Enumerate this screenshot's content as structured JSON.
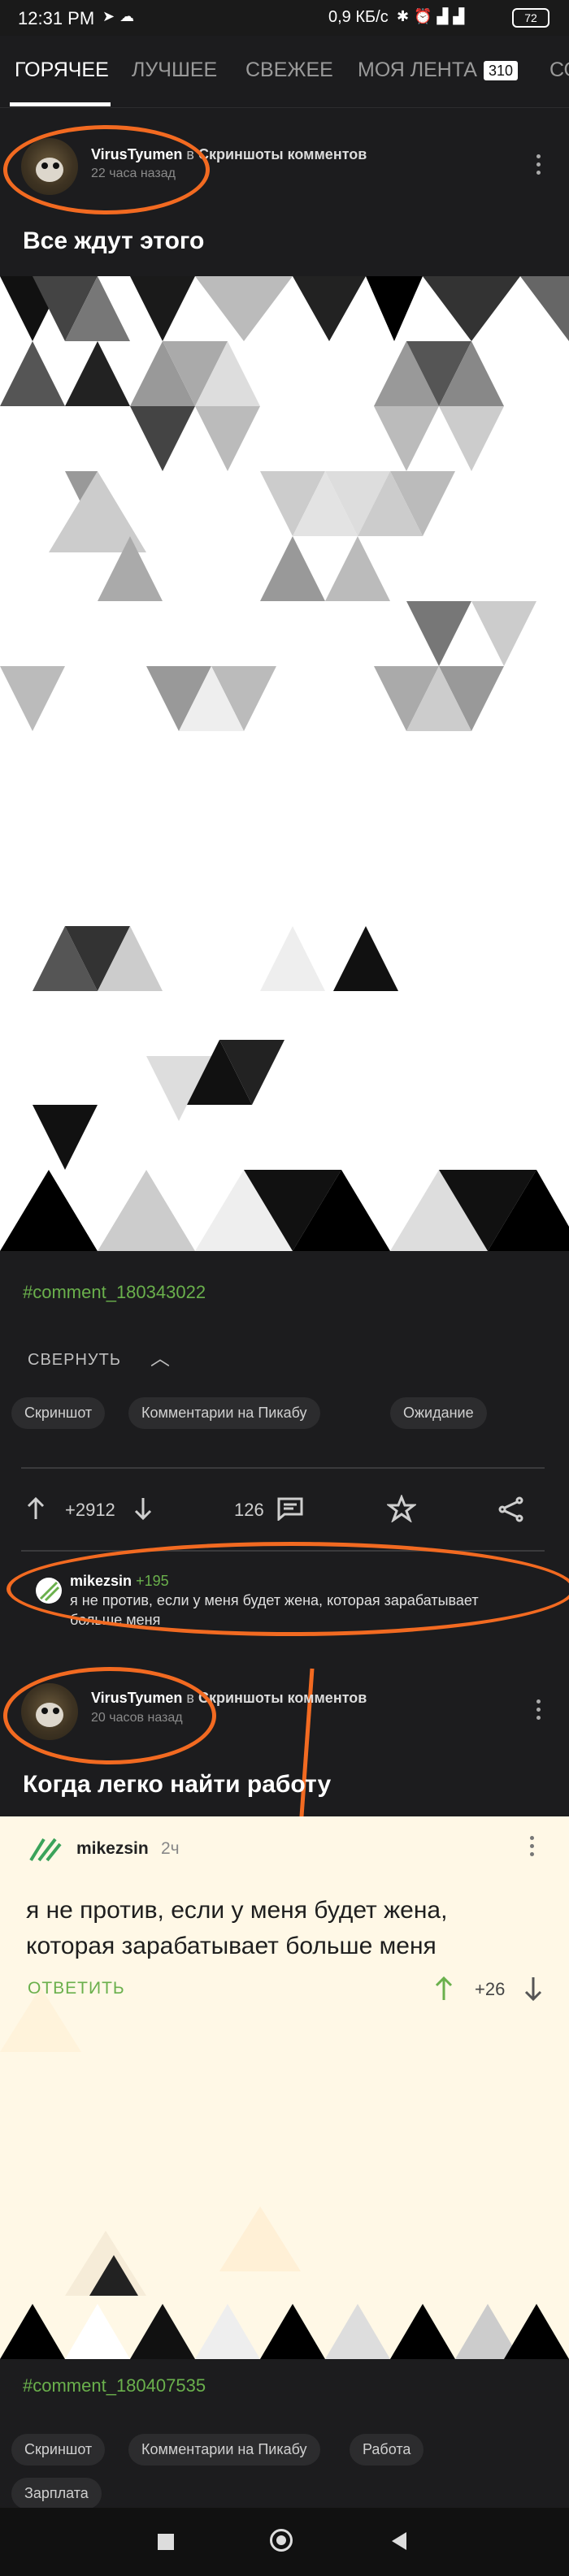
{
  "status_bar": {
    "time": "12:31 PM",
    "speed": "0,9 КБ/с",
    "battery": "72"
  },
  "tabs": {
    "items": [
      "ГОРЯЧЕЕ",
      "ЛУЧШЕЕ",
      "СВЕЖЕЕ",
      "МОЯ ЛЕНТА",
      "СО"
    ],
    "feed_count": "310"
  },
  "post1": {
    "author": "VirusTyumen",
    "in_word": "в",
    "community": "Скриншоты комментов",
    "time_ago": "22 часа назад",
    "title": "Все ждут этого",
    "hashtag": "#comment_180343022",
    "collapse_label": "СВЕРНУТЬ",
    "tags": [
      "Скриншот",
      "Комментарии на Пикабу",
      "Ожидание"
    ],
    "rating": "+2912",
    "comments_count": "126"
  },
  "comment_preview": {
    "author": "mikezsin",
    "rating": "+195",
    "text": "я не против, если у меня будет жена, которая зарабатывает больше меня"
  },
  "post2": {
    "author": "VirusTyumen",
    "in_word": "в",
    "community": "Скриншоты комментов",
    "time_ago": "20 часов назад",
    "title": "Когда легко найти работу",
    "card_author": "mikezsin",
    "card_time": "2ч",
    "card_text_line1": "я не против, если у меня будет жена,",
    "card_text_line2": "которая зарабатывает больше меня",
    "reply_label": "ОТВЕТИТЬ",
    "card_rating": "+26",
    "hashtag": "#comment_180407535",
    "tags": [
      "Скриншот",
      "Комментарии на Пикабу",
      "Работа",
      "Зарплата"
    ]
  },
  "colors": {
    "accent_orange": "#f26a21",
    "accent_green": "#6ab04c",
    "background": "#1c1c1e",
    "card_cream": "#fff8e6"
  },
  "icons": [
    "telegram-icon",
    "bluetooth-icon",
    "alarm-icon",
    "signal-icon",
    "battery-icon",
    "upvote-icon",
    "downvote-icon",
    "comments-icon",
    "star-icon",
    "share-icon",
    "more-icon",
    "chevron-up-icon",
    "stop-icon",
    "home-icon",
    "back-icon"
  ]
}
